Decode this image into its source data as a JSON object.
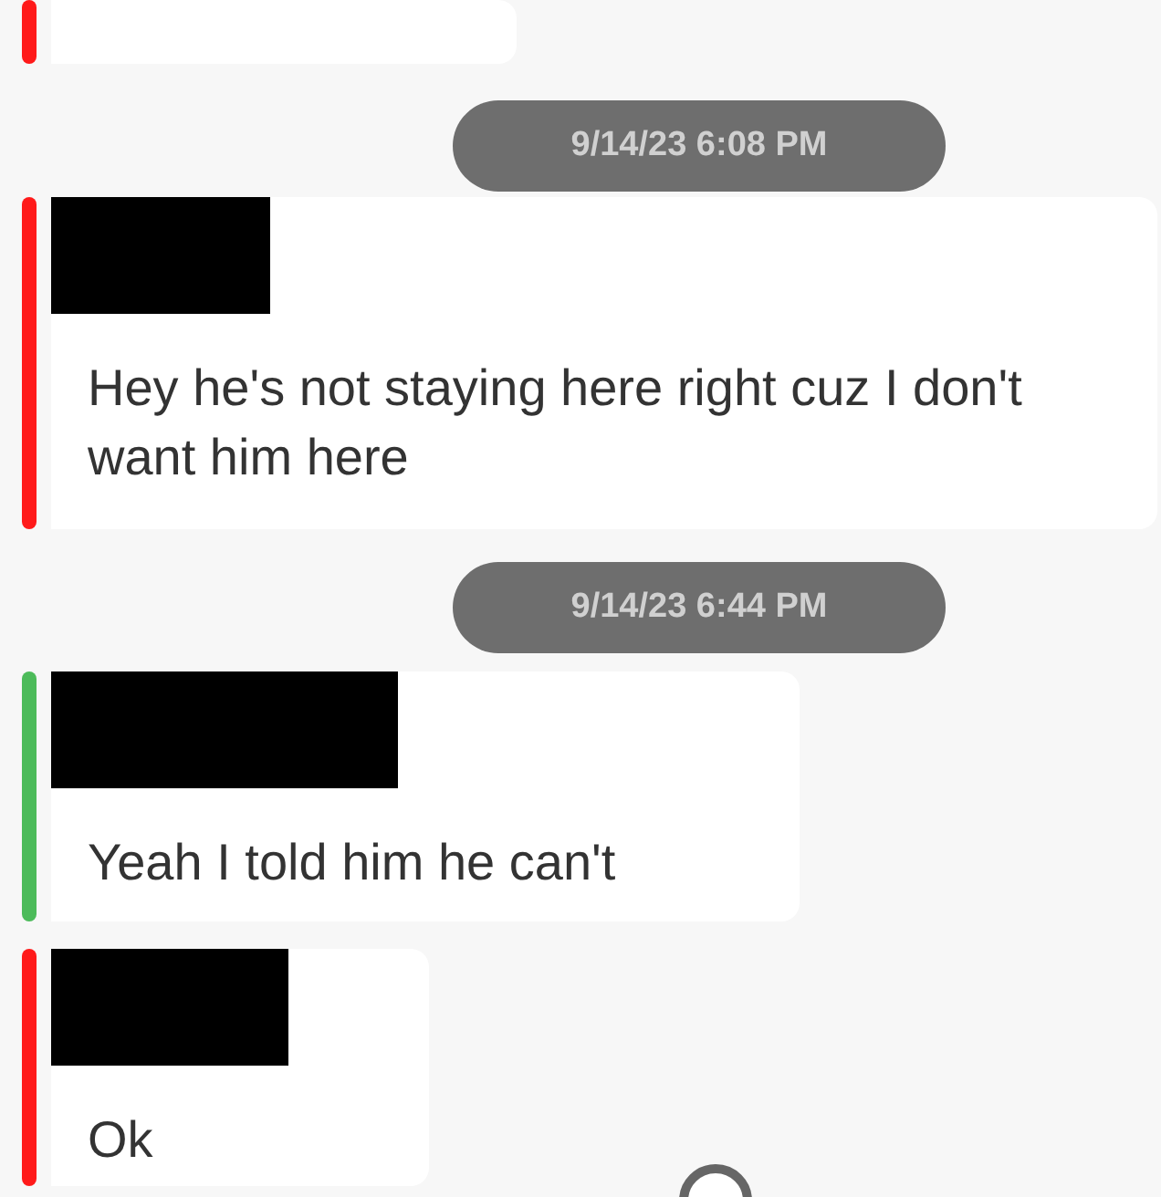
{
  "messages": [
    {
      "kind": "message",
      "color": "#ff1a1a"
    },
    {
      "kind": "timestamp",
      "text": "9/14/23 6:08 PM"
    },
    {
      "kind": "message",
      "color": "#ff1a1a",
      "redacted": true,
      "text": "Hey he's not staying here right cuz I don't want him here"
    },
    {
      "kind": "timestamp",
      "text": "9/14/23 6:44 PM"
    },
    {
      "kind": "message",
      "color": "#4cbb5a",
      "redacted": true,
      "text": "Yeah I told him he can't"
    },
    {
      "kind": "message",
      "color": "#ff1a1a",
      "redacted": true,
      "text": "Ok"
    }
  ]
}
